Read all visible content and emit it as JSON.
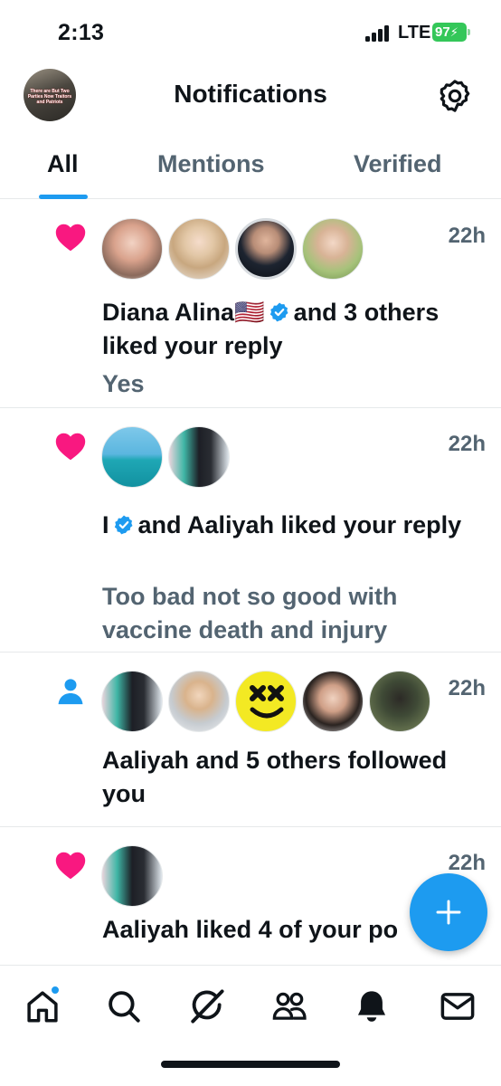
{
  "status_bar": {
    "time": "2:13",
    "network": "LTE",
    "battery": "97"
  },
  "header": {
    "title": "Notifications",
    "profile_avatar_caption": "There are But Two Parties Now Traitors and Patriots"
  },
  "tabs": [
    {
      "label": "All",
      "active": true
    },
    {
      "label": "Mentions",
      "active": false
    },
    {
      "label": "Verified",
      "active": false
    }
  ],
  "colors": {
    "accent": "#1d9bf0",
    "like": "#f91880",
    "follow": "#1d9bf0",
    "text_primary": "#0f1419",
    "text_secondary": "#536471"
  },
  "notifications": [
    {
      "type": "like",
      "icon": "heart-icon",
      "time": "22h",
      "actor": "Diana Alina",
      "actor_flag": "🇺🇸",
      "verified": true,
      "text_rest": "and 3 others liked your reply",
      "subtext": "Yes"
    },
    {
      "type": "like",
      "icon": "heart-icon",
      "time": "22h",
      "actor": "I",
      "verified": true,
      "text_rest": "and Aaliyah liked your reply",
      "subtext": "Too bad not so good with vaccine death and injury"
    },
    {
      "type": "follow",
      "icon": "person-icon",
      "time": "22h",
      "text": "Aaliyah and 5 others followed you"
    },
    {
      "type": "like",
      "icon": "heart-icon",
      "time": "22h",
      "text": "Aaliyah liked 4 of your po"
    }
  ],
  "bottom_nav": [
    {
      "label": "Home",
      "icon": "home-icon",
      "has_dot": true
    },
    {
      "label": "Search",
      "icon": "search-icon"
    },
    {
      "label": "Grok",
      "icon": "grok-icon"
    },
    {
      "label": "Communities",
      "icon": "communities-icon"
    },
    {
      "label": "Notifications",
      "icon": "bell-icon"
    },
    {
      "label": "Messages",
      "icon": "mail-icon"
    }
  ]
}
